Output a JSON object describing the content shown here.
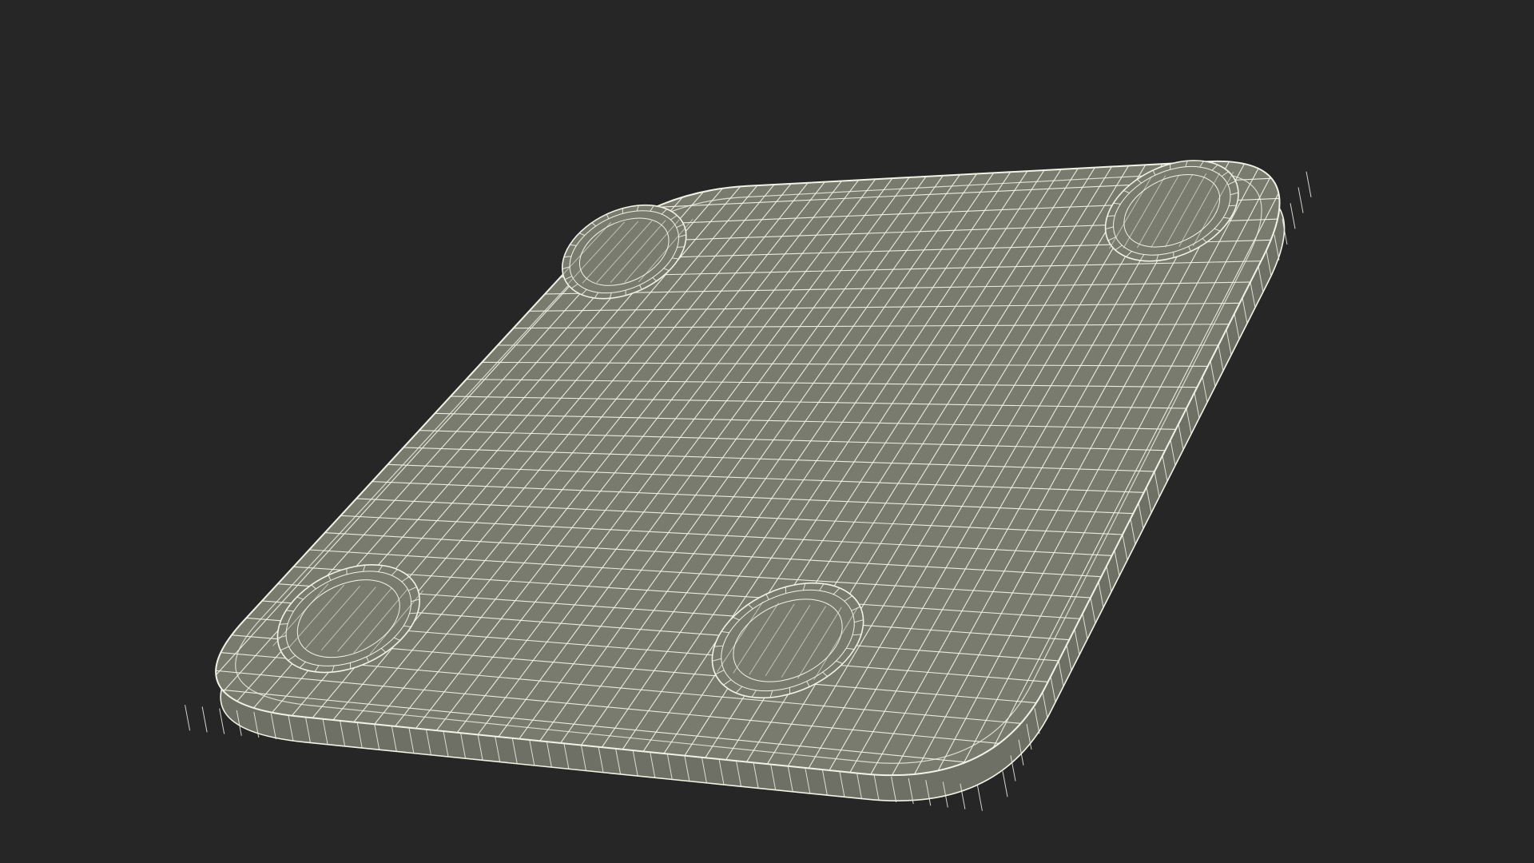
{
  "scene": {
    "subject": "wireframe-mesh",
    "background_color": "#262626",
    "surface_color": "#7a7b6f",
    "side_color": "#6f7065",
    "wire_color": "#f2f2e6",
    "feet_count": 4
  }
}
